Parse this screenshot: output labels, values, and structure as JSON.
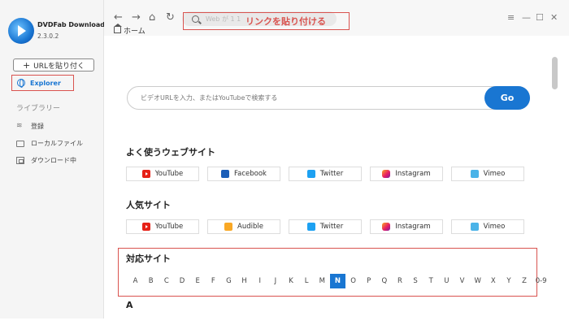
{
  "app": {
    "name": "DVDFab Downloader",
    "version": "2.3.0.2"
  },
  "sidebar": {
    "paste_button": "URLを貼り付く",
    "explorer_label": "Explorer",
    "library_title": "ライブラリー",
    "items": [
      {
        "label": "登録",
        "icon": "rss-icon"
      },
      {
        "label": "ローカルファイル",
        "icon": "folder-icon"
      },
      {
        "label": "ダウンロード中",
        "icon": "download-icon"
      }
    ]
  },
  "toolbar": {
    "address_placeholder": "Web が 1 1",
    "annotation": "リンクを貼り付ける",
    "tab_label": "ホーム"
  },
  "main": {
    "search_placeholder": "ビデオURLを入力、またはYouTubeで検索する",
    "go_label": "Go",
    "popular_title": "よく使うウェブサイト",
    "popular_sites": [
      "YouTube",
      "Facebook",
      "Twitter",
      "Instagram",
      "Vimeo"
    ],
    "trending_title": "人気サイト",
    "trending_sites": [
      "YouTube",
      "Audible",
      "Twitter",
      "Instagram",
      "Vimeo"
    ],
    "supported_title": "対応サイト",
    "letters": [
      "A",
      "B",
      "C",
      "D",
      "E",
      "F",
      "G",
      "H",
      "I",
      "J",
      "K",
      "L",
      "M",
      "N",
      "O",
      "P",
      "Q",
      "R",
      "S",
      "T",
      "U",
      "V",
      "W",
      "X",
      "Y",
      "Z",
      "0-9"
    ],
    "active_letter": "N",
    "section_heading": "A"
  },
  "colors": {
    "accent": "#1976d2",
    "annotation": "#d9534f",
    "sidebar_bg": "#f5f5f5"
  }
}
